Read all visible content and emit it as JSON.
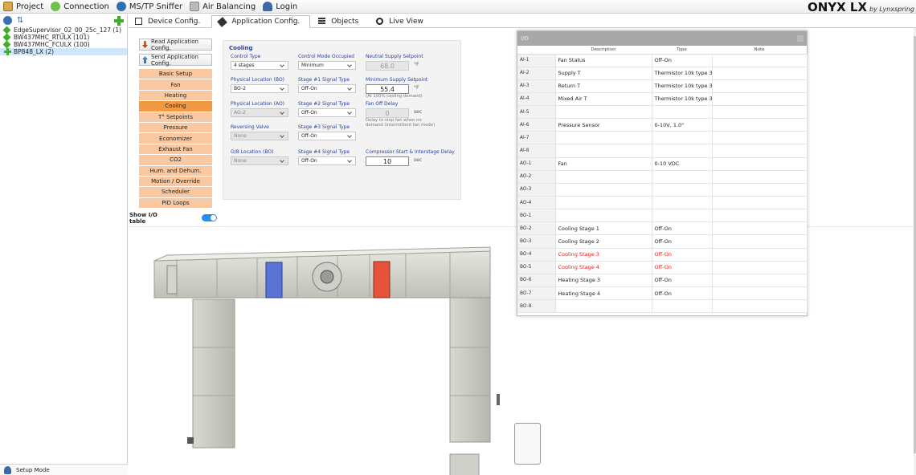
{
  "menu": [
    {
      "label": "Project",
      "icon": "folder-icon"
    },
    {
      "label": "Connection",
      "icon": "connection-icon"
    },
    {
      "label": "MS/TP Sniffer",
      "icon": "sniffer-icon"
    },
    {
      "label": "Air Balancing",
      "icon": "air-balancing-icon"
    },
    {
      "label": "Login",
      "icon": "user-icon"
    }
  ],
  "brand": {
    "logo": "ONYX LX",
    "tagline": "by Lynxspring"
  },
  "tree": [
    {
      "label": "EdgeSupervisor_02_00_25c_127 (1)",
      "color": "#3fae2a",
      "kind": "diamond"
    },
    {
      "label": "BW437MHC_RTULX (101)",
      "color": "#3fae2a",
      "kind": "diamond"
    },
    {
      "label": "BW437MHC_FCULX (100)",
      "color": "#3fae2a",
      "kind": "diamond"
    },
    {
      "label": "BP848_LX (2)",
      "color": "#3fae2a",
      "kind": "plus",
      "selected": true
    }
  ],
  "status": {
    "mode": "Setup Mode"
  },
  "tabs": [
    {
      "label": "Device Config.",
      "icon": "device-icon"
    },
    {
      "label": "Application Config.",
      "icon": "wrench-icon",
      "active": true
    },
    {
      "label": "Objects",
      "icon": "list-icon"
    },
    {
      "label": "Live View",
      "icon": "eye-icon"
    }
  ],
  "actions": {
    "read": "Read Application Config.",
    "send": "Send Application Config."
  },
  "nav": [
    "Basic Setup",
    "Fan",
    "Heating",
    "Cooling",
    "T° Setpoints",
    "Pressure",
    "Economizer",
    "Exhaust Fan",
    "CO2",
    "Hum. and Dehum.",
    "Motion / Override",
    "Scheduler",
    "PID Loops"
  ],
  "nav_active": "Cooling",
  "show_io": {
    "label": "Show I/O table",
    "on": true
  },
  "cooling": {
    "title": "Cooling",
    "control_type": {
      "label": "Control Type",
      "value": "4 stages"
    },
    "phys_bo": {
      "label": "Physical Location (BO)",
      "value": "BO-2"
    },
    "phys_ao": {
      "label": "Physical Location (AO)",
      "value": "AO-2"
    },
    "reversing": {
      "label": "Reversing Valve",
      "value": "None"
    },
    "ob_loc": {
      "label": "O/B Location (BO)",
      "value": "None"
    },
    "mode_occ": {
      "label": "Control Mode Occupied",
      "value": "Minimum"
    },
    "s1": {
      "label": "Stage #1 Signal Type",
      "value": "Off-On"
    },
    "s2": {
      "label": "Stage #2 Signal Type",
      "value": "Off-On"
    },
    "s3": {
      "label": "Stage #3 Signal Type",
      "value": "Off-On"
    },
    "s4": {
      "label": "Stage #4 Signal Type",
      "value": "Off-On"
    },
    "neutral": {
      "label": "Neutral Supply Setpoint",
      "value": "68.0",
      "unit": "°F"
    },
    "min_supply": {
      "label": "Minimum Supply Setpoint",
      "value": "55.4",
      "unit": "°F",
      "note": "(At 100% cooling demand)"
    },
    "fan_off": {
      "label": "Fan Off Delay",
      "value": "0",
      "unit": "sec",
      "note1": "Delay to stop fan when no",
      "note2": "demand (intermittent fan mode)"
    },
    "compressor": {
      "label": "Compressor Start & Interstage Delay",
      "value": "10",
      "unit": "sec"
    }
  },
  "io": {
    "title": "I/O",
    "headers": [
      "",
      "Description",
      "Type",
      "Note"
    ],
    "rows": [
      {
        "pt": "AI-1",
        "desc": "Fan Status",
        "type": "Off-On",
        "note": ""
      },
      {
        "pt": "AI-2",
        "desc": "Supply T",
        "type": "Thermistor 10k type 3",
        "note": ""
      },
      {
        "pt": "AI-3",
        "desc": "Return T",
        "type": "Thermistor 10k type 3",
        "note": ""
      },
      {
        "pt": "AI-4",
        "desc": "Mixed Air T",
        "type": "Thermistor 10k type 3",
        "note": ""
      },
      {
        "pt": "AI-5",
        "desc": "",
        "type": "",
        "note": ""
      },
      {
        "pt": "AI-6",
        "desc": "Pressure Sensor",
        "type": "0-10V, 1.0\"",
        "note": ""
      },
      {
        "pt": "AI-7",
        "desc": "",
        "type": "",
        "note": ""
      },
      {
        "pt": "AI-8",
        "desc": "",
        "type": "",
        "note": ""
      },
      {
        "pt": "AO-1",
        "desc": "Fan",
        "type": "0-10 VDC",
        "note": ""
      },
      {
        "pt": "AO-2",
        "desc": "",
        "type": "",
        "note": ""
      },
      {
        "pt": "AO-3",
        "desc": "",
        "type": "",
        "note": ""
      },
      {
        "pt": "AO-4",
        "desc": "",
        "type": "",
        "note": ""
      },
      {
        "pt": "BO-1",
        "desc": "",
        "type": "",
        "note": ""
      },
      {
        "pt": "BO-2",
        "desc": "Cooling Stage 1",
        "type": "Off-On",
        "note": ""
      },
      {
        "pt": "BO-3",
        "desc": "Cooling Stage 2",
        "type": "Off-On",
        "note": ""
      },
      {
        "pt": "BO-4",
        "desc": "Cooling Stage 3",
        "type": "Off-On",
        "note": "",
        "red": true
      },
      {
        "pt": "BO-5",
        "desc": "Cooling Stage 4",
        "type": "Off-On",
        "note": "",
        "red": true
      },
      {
        "pt": "BO-6",
        "desc": "Heating Stage 3",
        "type": "Off-On",
        "note": ""
      },
      {
        "pt": "BO-7",
        "desc": "Heating Stage 4",
        "type": "Off-On",
        "note": ""
      },
      {
        "pt": "BO-8",
        "desc": "",
        "type": "",
        "note": ""
      }
    ]
  },
  "colors": {
    "accent": "#f29a43",
    "nav_bg": "#f9c8a0",
    "label_blue": "#2a3fa0",
    "warning_red": "#e02020"
  }
}
